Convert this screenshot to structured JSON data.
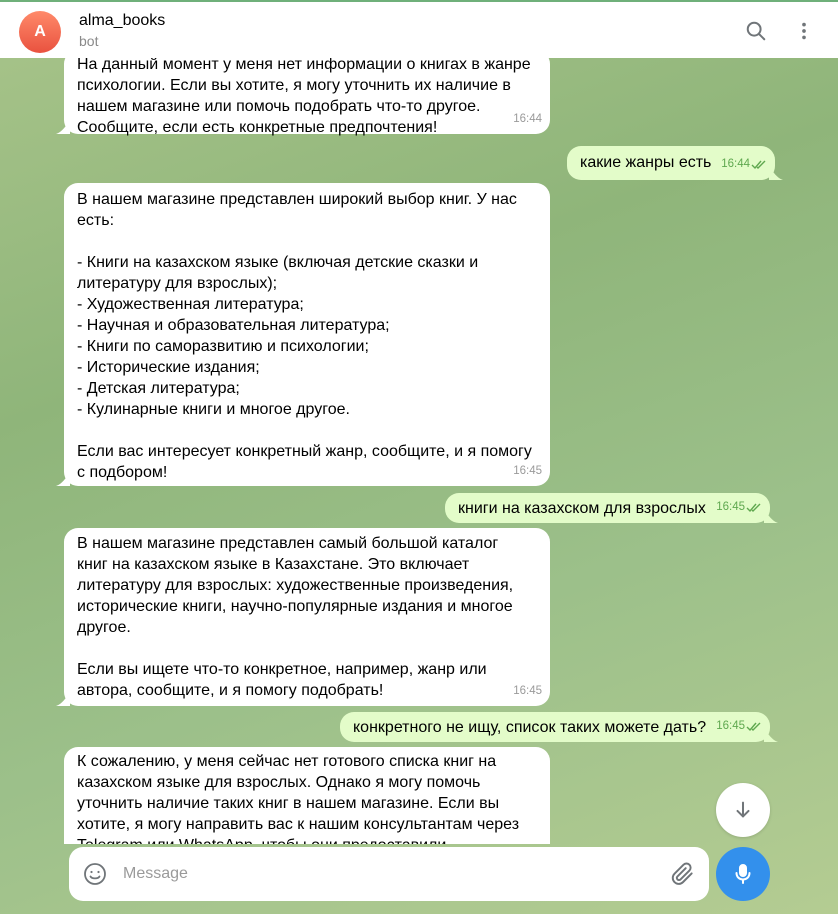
{
  "header": {
    "avatar_letter": "A",
    "title": "alma_books",
    "subtitle": "bot"
  },
  "messages": [
    {
      "direction": "in",
      "text": "На данный момент у меня нет информации о книгах в жанре\nпсихологии. Если вы хотите, я могу уточнить их наличие в\nнашем магазине или помочь подобрать что-то другое.\nСообщите, если есть конкретные предпочтения!",
      "time": "16:44"
    },
    {
      "direction": "out",
      "text": "какие жанры есть",
      "time": "16:44"
    },
    {
      "direction": "in",
      "text": "В нашем магазине представлен широкий выбор книг. У нас\nесть:\n\n- Книги на казахском языке (включая детские сказки и\nлитературу для взрослых);\n- Художественная литература;\n- Научная и образовательная литература;\n- Книги по саморазвитию и психологии;\n- Исторические издания;\n- Детская литература;\n- Кулинарные книги и многое другое.\n\nЕсли вас интересует конкретный жанр, сообщите, и я помогу\nс подбором!",
      "time": "16:45"
    },
    {
      "direction": "out",
      "text": "книги на казахском для взрослых",
      "time": "16:45"
    },
    {
      "direction": "in",
      "text": "В нашем магазине представлен самый большой каталог\nкниг на казахском языке в Казахстане. Это включает\nлитературу для взрослых: художественные произведения,\nисторические книги, научно-популярные издания и многое\nдругое.\n\nЕсли вы ищете что-то конкретное, например, жанр или\nавтора, сообщите, и я помогу подобрать!",
      "time": "16:45"
    },
    {
      "direction": "out",
      "text": "конкретного не ищу, список таких можете дать?",
      "time": "16:45"
    },
    {
      "direction": "in",
      "text": "К сожалению, у меня сейчас нет готового списка книг на\nказахском языке для взрослых. Однако я могу помочь\nуточнить наличие таких книг в нашем магазине. Если вы\nхотите, я могу направить вас к нашим консультантам через\nTelegram или WhatsApp, чтобы они предоставили",
      "time": ""
    }
  ],
  "composer": {
    "placeholder": "Message"
  },
  "icons": {
    "search": "search-icon",
    "menu": "more-vertical-icon",
    "emoji": "smile-icon",
    "attach": "paperclip-icon",
    "mic": "microphone-icon",
    "scroll": "arrow-down-icon",
    "read": "double-check-icon"
  },
  "colors": {
    "accent": "#3390ec",
    "outgoing_bubble": "#e3fcc9",
    "incoming_bubble": "#ffffff",
    "read_check": "#5fa84f",
    "avatar": "#e9523f"
  }
}
